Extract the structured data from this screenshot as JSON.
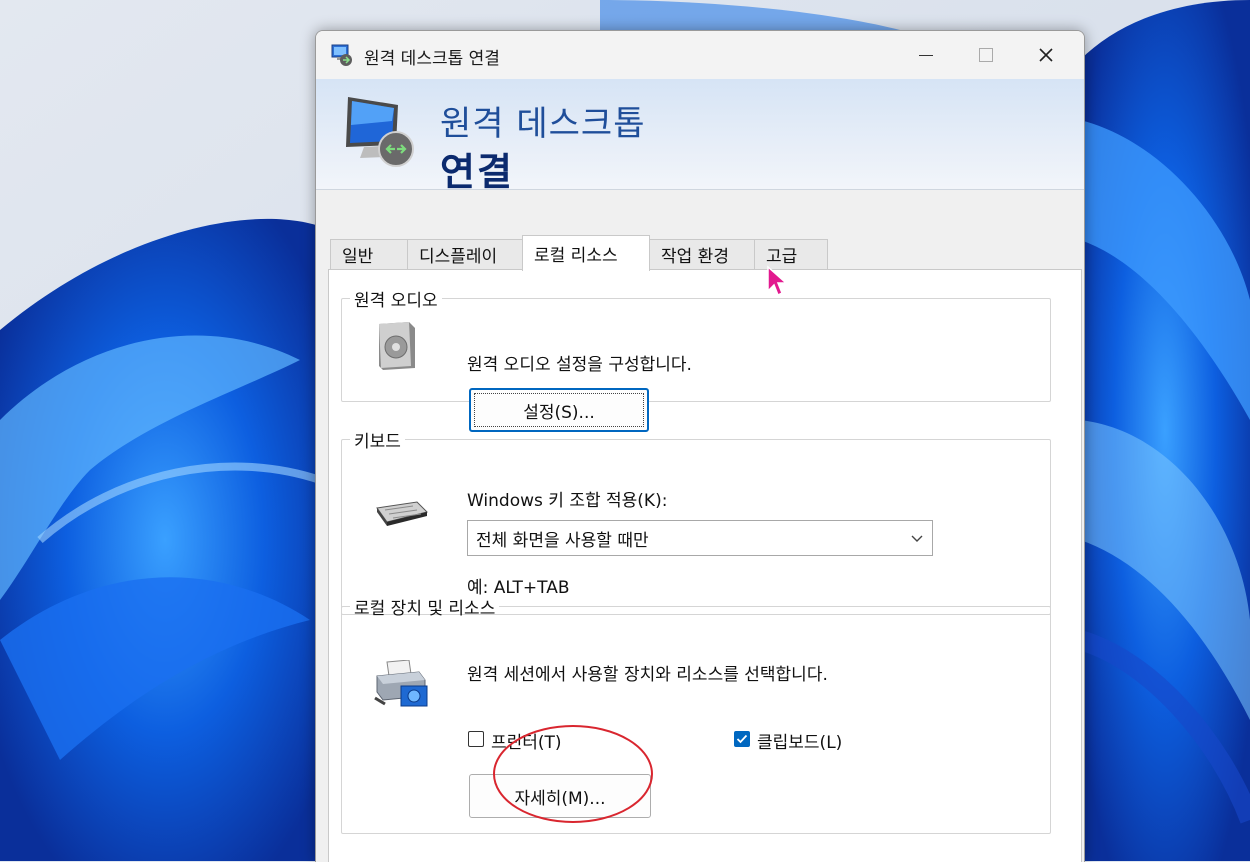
{
  "window": {
    "title": "원격 데스크톱 연결",
    "banner_line1": "원격 데스크톱",
    "banner_line2": "연결"
  },
  "tabs": [
    {
      "label": "일반",
      "active": false
    },
    {
      "label": "디스플레이",
      "active": false
    },
    {
      "label": "로컬 리소스",
      "active": true
    },
    {
      "label": "작업 환경",
      "active": false
    },
    {
      "label": "고급",
      "active": false
    }
  ],
  "audio": {
    "legend": "원격 오디오",
    "description": "원격 오디오 설정을 구성합니다.",
    "settings_button": "설정(S)..."
  },
  "keyboard": {
    "legend": "키보드",
    "label": "Windows 키 조합 적용(K):",
    "selected": "전체 화면을 사용할 때만",
    "example": "예: ALT+TAB"
  },
  "devices": {
    "legend": "로컬 장치 및 리소스",
    "description": "원격 세션에서 사용할 장치와 리소스를 선택합니다.",
    "printer_label": "프린터(T)",
    "printer_checked": false,
    "clipboard_label": "클립보드(L)",
    "clipboard_checked": true,
    "more_button": "자세히(M)..."
  },
  "colors": {
    "accent": "#0067c0",
    "banner_title": "#1f4e9a",
    "annotation": "#d9262f"
  }
}
